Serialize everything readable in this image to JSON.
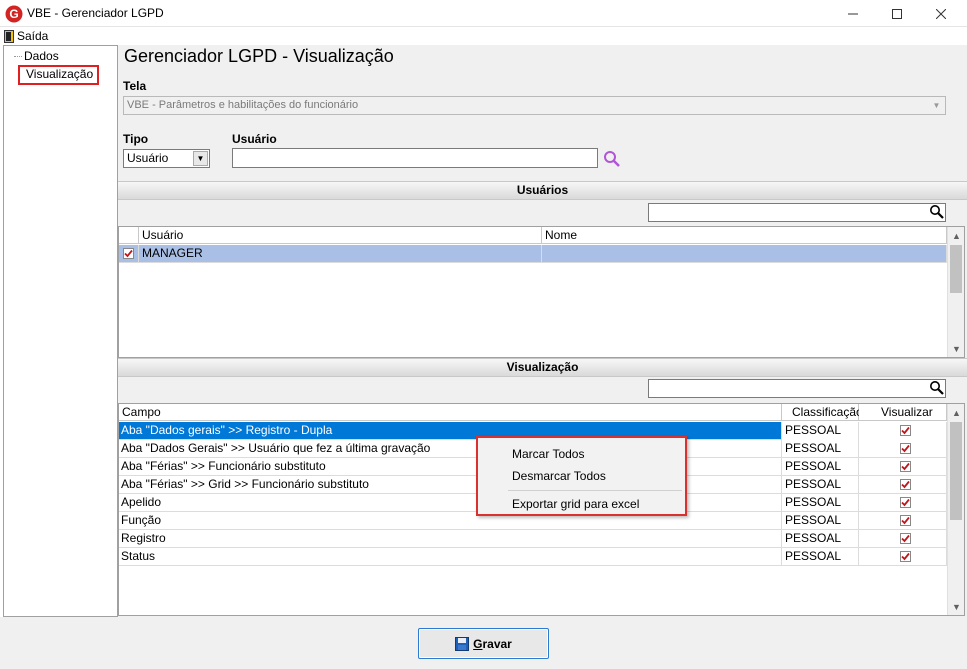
{
  "window": {
    "title": "VBE - Gerenciador LGPD",
    "accent": "#d93030"
  },
  "menu": {
    "exit_label": "Saída"
  },
  "nav": {
    "items": [
      "Dados",
      "Visualização"
    ]
  },
  "page": {
    "title": "Gerenciador LGPD - Visualização"
  },
  "form": {
    "tela_label": "Tela",
    "tela_value": "VBE - Parâmetros e habilitações do funcionário",
    "tipo_label": "Tipo",
    "tipo_value": "Usuário",
    "usuario_label": "Usuário",
    "usuario_value": ""
  },
  "users_section": {
    "title": "Usuários",
    "filter_value": "",
    "columns": [
      "Usuário",
      "Nome"
    ],
    "rows": [
      {
        "checked": true,
        "usuario": "MANAGER",
        "nome": ""
      }
    ]
  },
  "vis_section": {
    "title": "Visualização",
    "filter_value": "",
    "columns": [
      "Campo",
      "Classificação",
      "Visualizar"
    ],
    "rows": [
      {
        "campo": "Aba \"Dados gerais\" >> Registro - Dupla",
        "classificacao": "PESSOAL",
        "visualizar": true
      },
      {
        "campo": "Aba \"Dados Gerais\" >> Usuário que fez a última gravação",
        "classificacao": "PESSOAL",
        "visualizar": true
      },
      {
        "campo": "Aba \"Férias\" >> Funcionário substituto",
        "classificacao": "PESSOAL",
        "visualizar": true
      },
      {
        "campo": "Aba \"Férias\" >> Grid >> Funcionário substituto",
        "classificacao": "PESSOAL",
        "visualizar": true
      },
      {
        "campo": "Apelido",
        "classificacao": "PESSOAL",
        "visualizar": true
      },
      {
        "campo": "Função",
        "classificacao": "PESSOAL",
        "visualizar": true
      },
      {
        "campo": "Registro",
        "classificacao": "PESSOAL",
        "visualizar": true
      },
      {
        "campo": "Status",
        "classificacao": "PESSOAL",
        "visualizar": true
      }
    ]
  },
  "context_menu": {
    "items": [
      "Marcar Todos",
      "Desmarcar Todos",
      "Exportar grid para excel"
    ]
  },
  "footer": {
    "save_label": "Gravar"
  },
  "icons": {
    "search": "magnifier-icon",
    "save": "floppy-icon",
    "exit": "door-icon"
  }
}
